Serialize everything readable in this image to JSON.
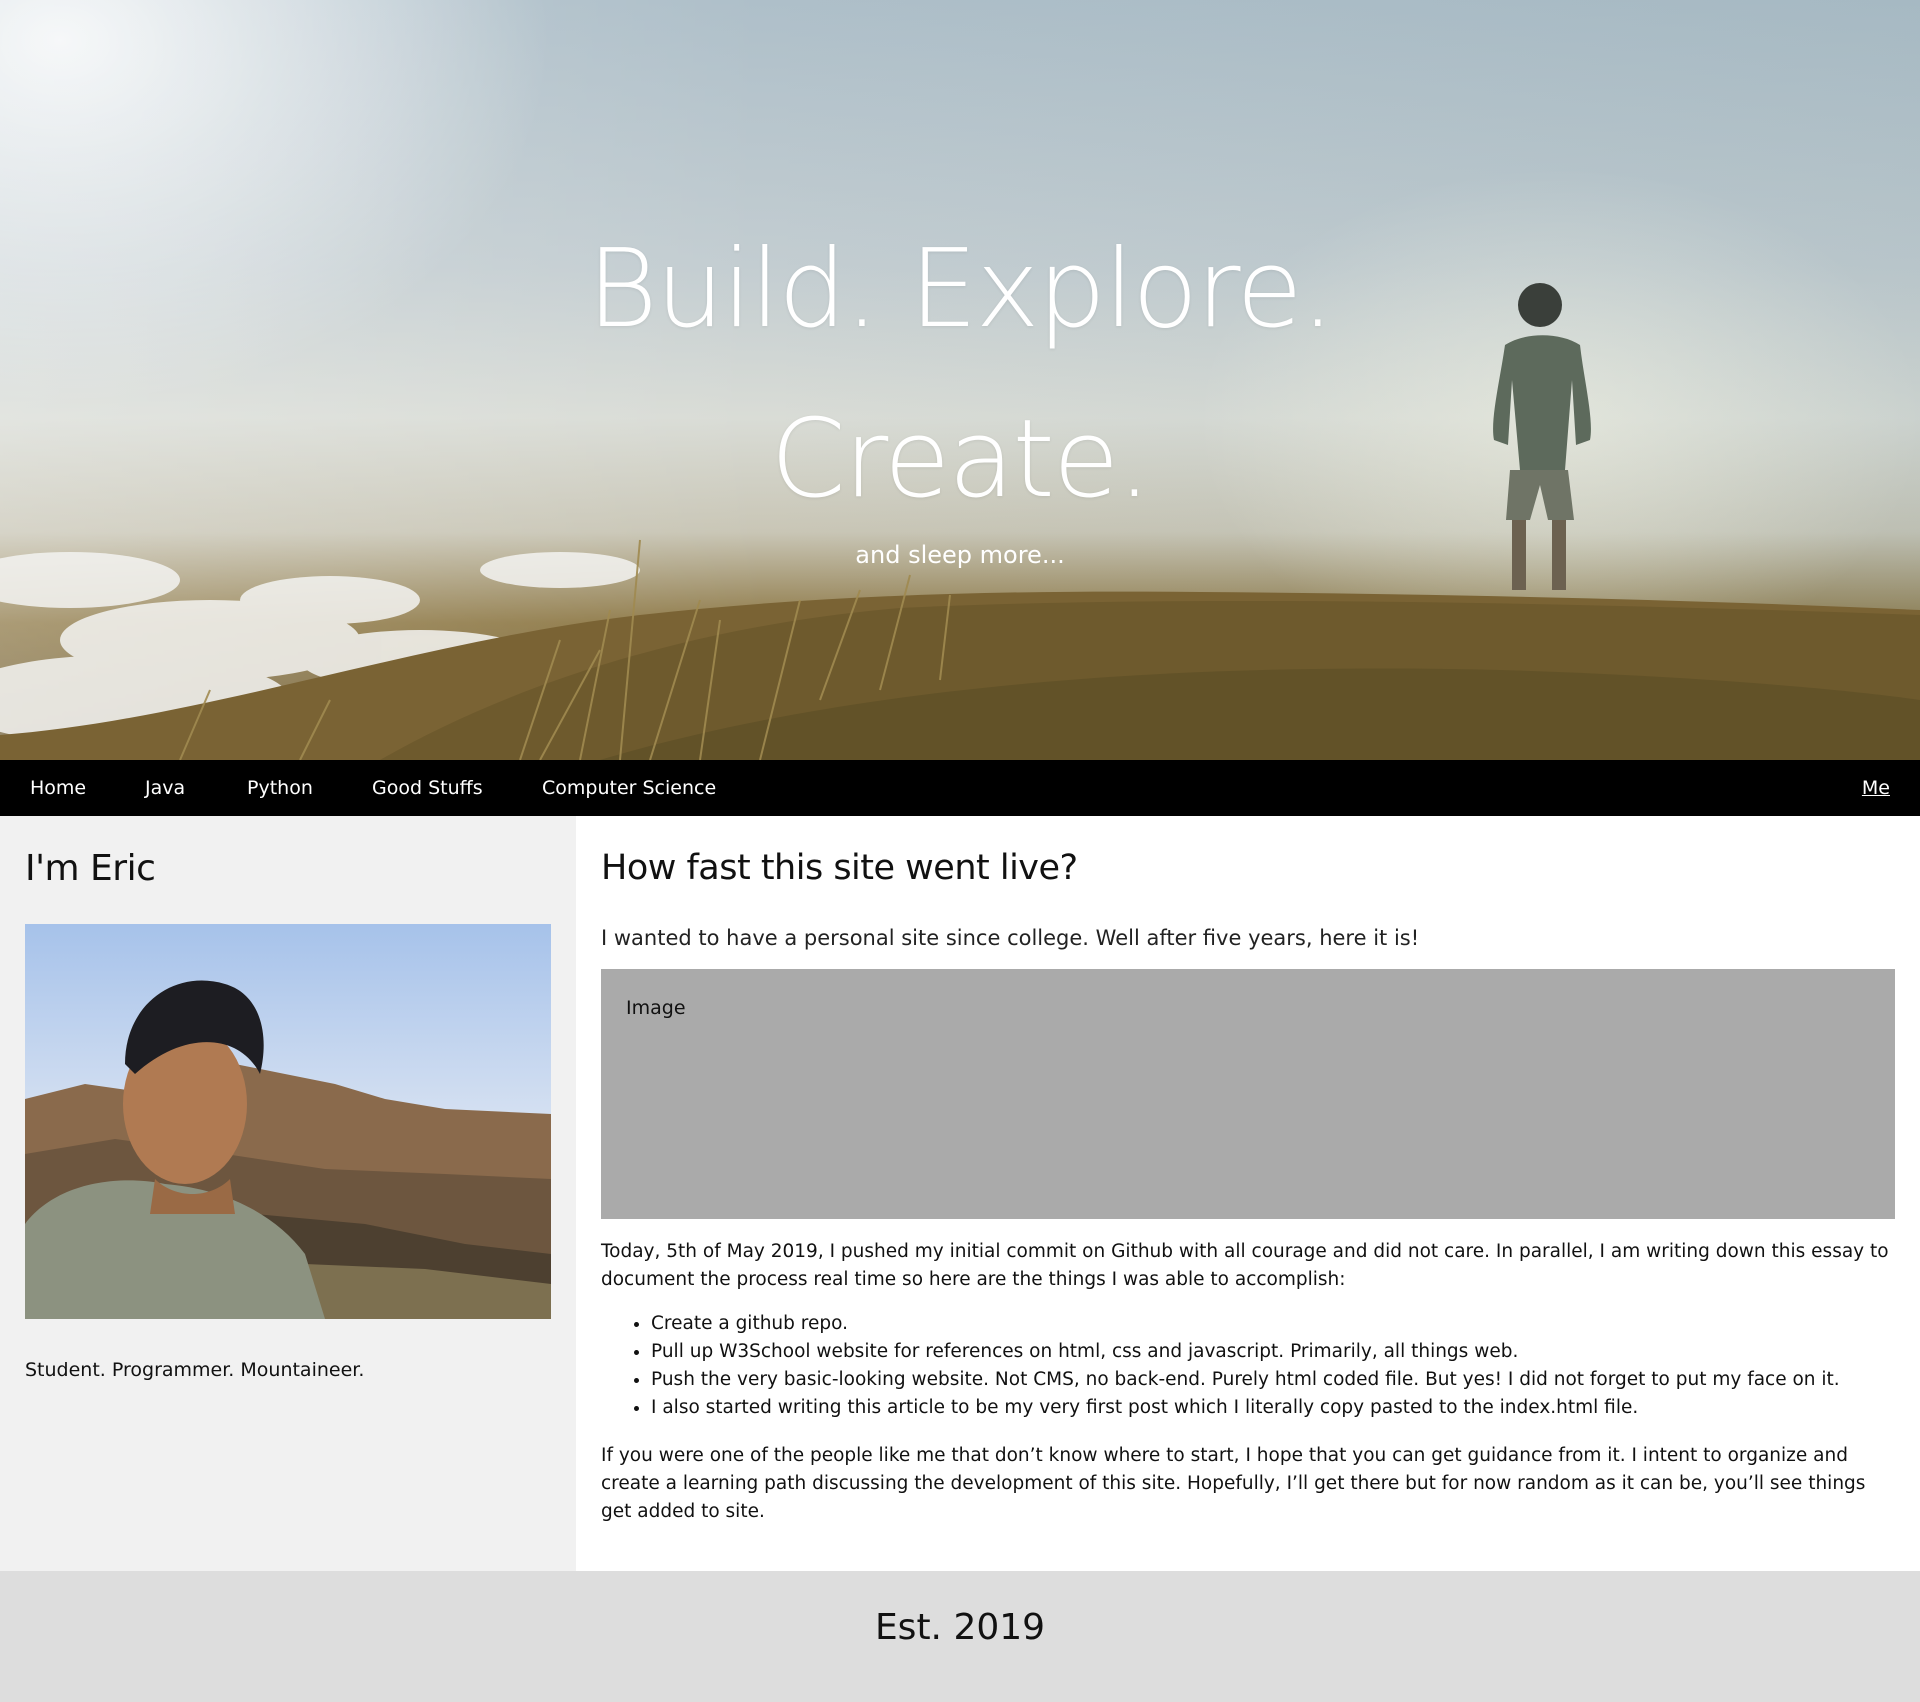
{
  "hero": {
    "title_line1": "Build. Explore.",
    "title_line2": "Create.",
    "subtitle": "and sleep more..."
  },
  "nav": {
    "items": [
      {
        "label": "Home"
      },
      {
        "label": "Java"
      },
      {
        "label": "Python"
      },
      {
        "label": "Good Stuffs"
      },
      {
        "label": "Computer Science"
      }
    ],
    "right_label": "Me"
  },
  "sidebar": {
    "heading": "I'm Eric",
    "tagline": "Student. Programmer. Mountaineer."
  },
  "main": {
    "heading": "How fast this site went live?",
    "intro": "I wanted to have a personal site since college. Well after five years, here it is!",
    "image_placeholder": "Image",
    "paragraph1": "Today, 5th of May 2019, I pushed my initial commit on Github with all courage and did not care. In parallel, I am writing down this essay to document the process real time so here are the things I was able to accomplish:",
    "list": [
      "Create a github repo.",
      "Pull up W3School website for references on html, css and javascript. Primarily, all things web.",
      "Push the very basic-looking website. Not CMS, no back-end. Purely html coded file. But yes! I did not forget to put my face on it.",
      "I also started writing this article to be my very first post which I literally copy pasted to the index.html file."
    ],
    "paragraph2": "If you were one of the people like me that don’t know where to start, I hope that you can get guidance from it. I intent to organize and create a learning path discussing the development of this site. Hopefully, I’ll get there but for now random as it can be, you’ll see things get added to site."
  },
  "footer": {
    "text": "Est. 2019"
  },
  "colors": {
    "navbar_bg": "#000000",
    "sidebar_bg": "#f1f1f1",
    "placeholder_bg": "#aaaaaa",
    "footer_bg": "#dddddd"
  }
}
